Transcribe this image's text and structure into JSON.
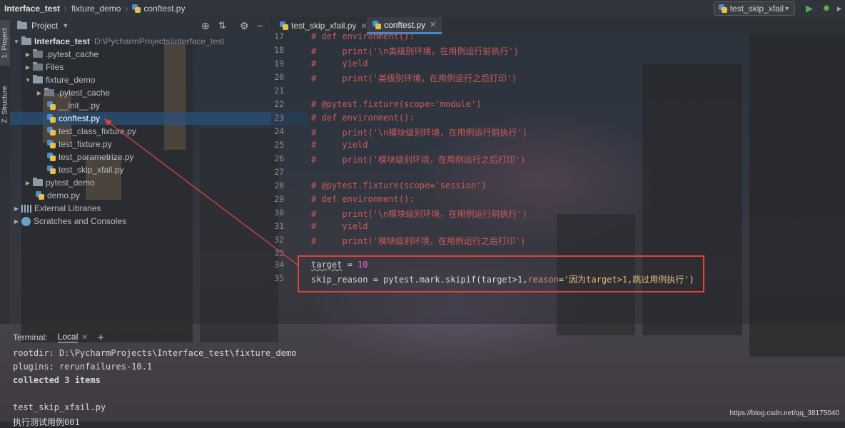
{
  "breadcrumb": {
    "project": "Interface_test",
    "folder": "fixture_demo",
    "file": "conftest.py"
  },
  "toolbar": {
    "run_config": "test_skip_xfail",
    "run_icon": "run-icon",
    "debug_icon": "debug-icon"
  },
  "tool_strip": {
    "project_tab": "1: Project",
    "structure_tab": "Z: Structure"
  },
  "project_panel": {
    "title": "Project",
    "root_label": "Interface_test",
    "root_path": "D:\\PycharmProjects\\Interface_test",
    "items": [
      {
        "label": ".pytest_cache"
      },
      {
        "label": "Files"
      },
      {
        "label": "fixture_demo"
      },
      {
        "label": ".pytest_cache"
      },
      {
        "label": "__init__.py"
      },
      {
        "label": "conftest.py"
      },
      {
        "label": "test_class_fixture.py"
      },
      {
        "label": "test_fixture.py"
      },
      {
        "label": "test_parametrize.py"
      },
      {
        "label": "test_skip_xfail.py"
      },
      {
        "label": "pytest_demo"
      },
      {
        "label": "demo.py"
      },
      {
        "label": "External Libraries"
      },
      {
        "label": "Scratches and Consoles"
      }
    ]
  },
  "editor": {
    "tabs": [
      {
        "label": "test_skip_xfail.py"
      },
      {
        "label": "conftest.py"
      }
    ],
    "lines": [
      {
        "n": "17",
        "text": "# def environment():"
      },
      {
        "n": "18",
        "text": "#     print('\\n类级别环境，在用例运行前执行')"
      },
      {
        "n": "19",
        "text": "#     yield"
      },
      {
        "n": "20",
        "text": "#     print('类级别环境，在用例运行之后打印')"
      },
      {
        "n": "21",
        "text": ""
      },
      {
        "n": "22",
        "text": "# @pytest.fixture(scope='module')"
      },
      {
        "n": "23",
        "text": "# def environment():"
      },
      {
        "n": "24",
        "text": "#     print('\\n模块级别环境，在用例运行前执行')"
      },
      {
        "n": "25",
        "text": "#     yield"
      },
      {
        "n": "26",
        "text": "#     print('模块级别环境，在用例运行之后打印')"
      },
      {
        "n": "27",
        "text": ""
      },
      {
        "n": "28",
        "text": "# @pytest.fixture(scope='session')"
      },
      {
        "n": "29",
        "text": "# def environment():"
      },
      {
        "n": "30",
        "text": "#     print('\\n模块级别环境，在用例运行前执行')"
      },
      {
        "n": "31",
        "text": "#     yield"
      },
      {
        "n": "32",
        "text": "#     print('模块级别环境，在用例运行之后打印')"
      },
      {
        "n": "33",
        "text": ""
      }
    ],
    "line34": {
      "n": "34",
      "var": "target",
      "op": " = ",
      "num": "10"
    },
    "line35": {
      "n": "35",
      "pre": "skip_reason = pytest.mark.skipif(target>1,",
      "kw": "reason",
      "eq": "=",
      "str": "'因为target>1,跳过用例执行'",
      "close": ")"
    }
  },
  "terminal": {
    "label": "Terminal:",
    "tab": "Local",
    "lines": [
      "rootdir: D:\\PycharmProjects\\Interface_test\\fixture_demo",
      "plugins: rerunfailures-10.1",
      "collected 3 items",
      "",
      "test_skip_xfail.py",
      "执行测试用例001"
    ]
  },
  "watermark": "https://blog.csdn.net/qq_38175040",
  "colors": {
    "highlight_border": "#e0423c",
    "comment": "#ce5a5a",
    "number": "#e26acb",
    "accent_tab": "#4a88c7"
  }
}
